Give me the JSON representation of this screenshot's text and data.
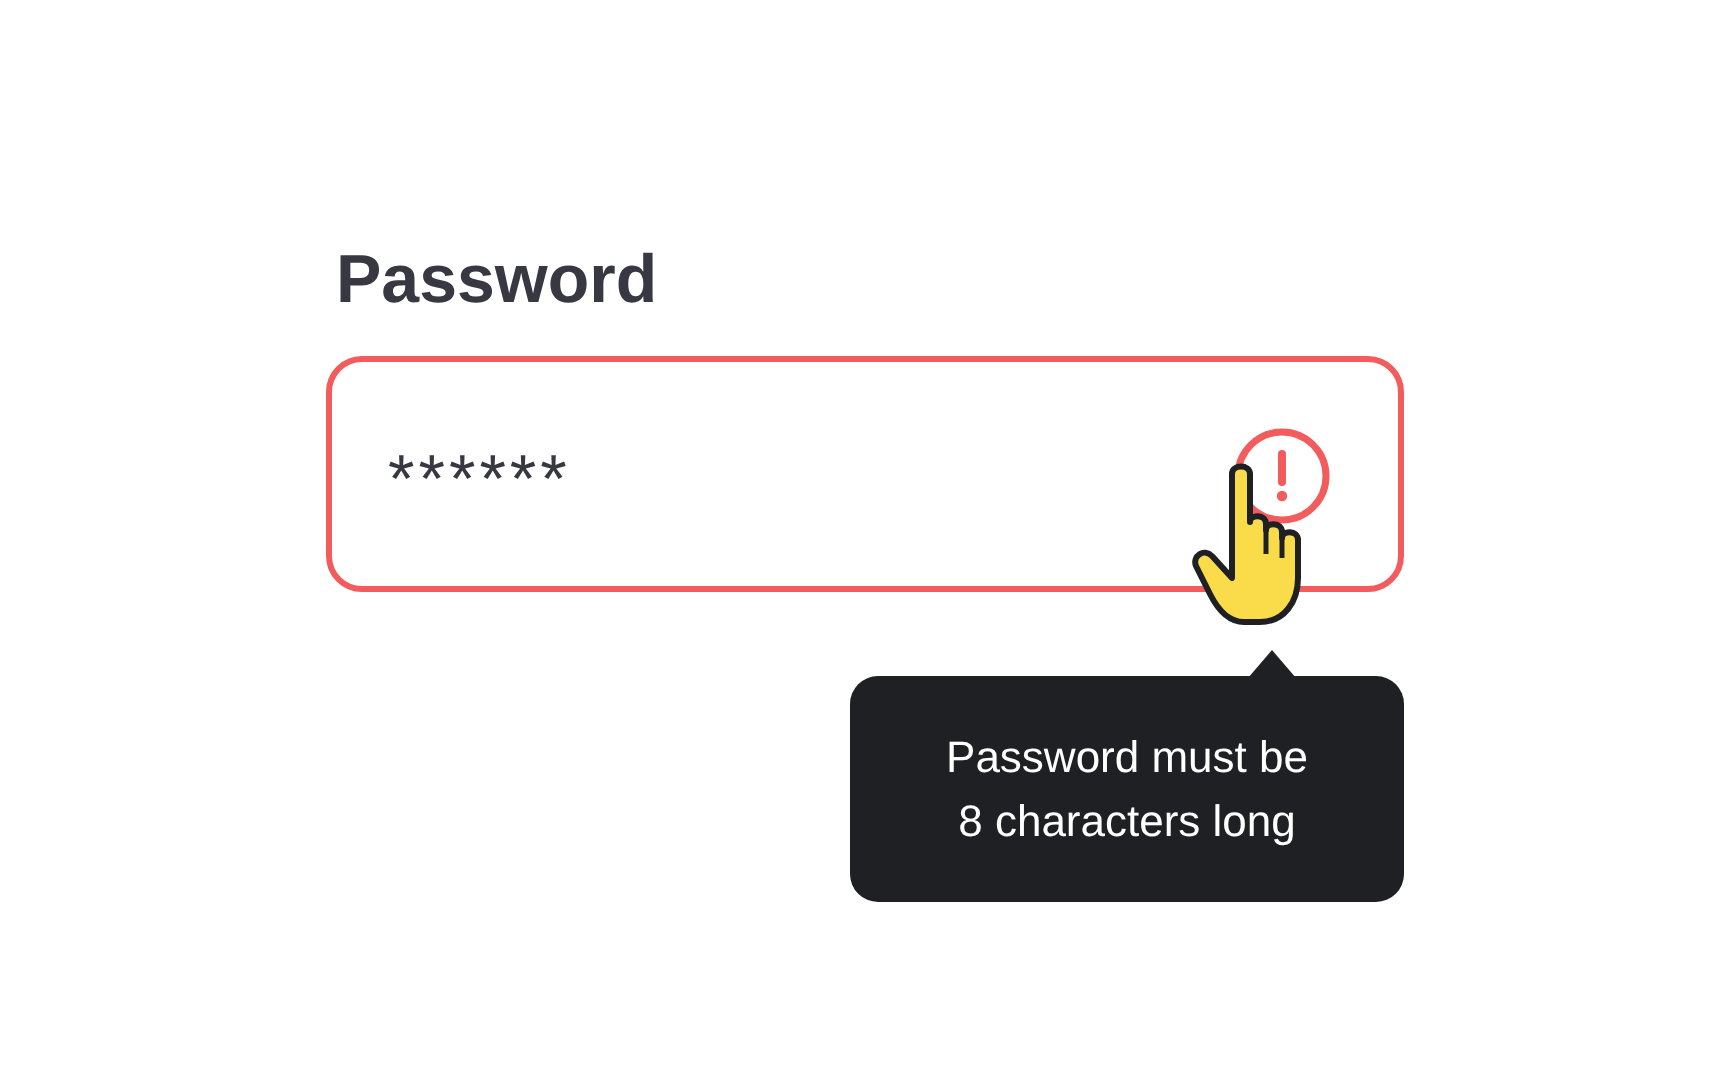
{
  "field": {
    "label": "Password",
    "value": "******",
    "error": true
  },
  "tooltip": {
    "text": "Password must be 8 characters long"
  }
}
